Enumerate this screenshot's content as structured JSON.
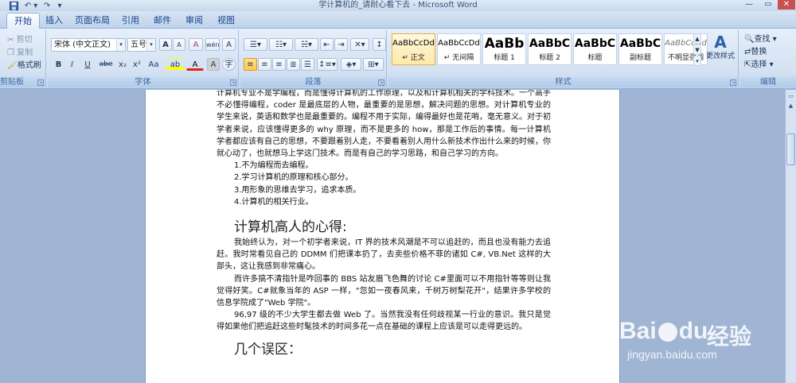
{
  "window": {
    "title": "学计算机的_请耐心看下去 - Microsoft Word",
    "quick_access": [
      "save-icon",
      "undo-icon",
      "redo-icon"
    ],
    "controls": [
      "minimize-icon",
      "maximize-icon",
      "close-icon"
    ]
  },
  "tabs": [
    "开始",
    "插入",
    "页面布局",
    "引用",
    "邮件",
    "审阅",
    "视图"
  ],
  "ribbon": {
    "clipboard": {
      "cut": "剪切",
      "copy": "复制",
      "format_painter": "格式刷",
      "label": "剪贴板"
    },
    "font": {
      "font_name": "宋体 (中文正文)",
      "font_size": "五号",
      "grow": "A",
      "shrink": "A",
      "clear": "A",
      "phonetic": "wén",
      "char_border": "A",
      "bold": "B",
      "italic": "I",
      "underline": "U",
      "strike": "abe",
      "subscript": "x₂",
      "superscript": "x²",
      "case": "Aa",
      "highlight": "ab",
      "font_color": "A",
      "char_shade": "A",
      "enclosed": "字",
      "label": "字体"
    },
    "paragraph": {
      "label": "段落"
    },
    "styles": {
      "items": [
        {
          "sample": "AaBbCcDd",
          "name": "↵ 正文"
        },
        {
          "sample": "AaBbCcDd",
          "name": "↵ 无间隔"
        },
        {
          "sample": "AaBb",
          "name": "标题 1"
        },
        {
          "sample": "AaBbC",
          "name": "标题 2"
        },
        {
          "sample": "AaBbC",
          "name": "标题"
        },
        {
          "sample": "AaBbC",
          "name": "副标题"
        },
        {
          "sample": "AaBbCcDd",
          "name": "不明显强调"
        }
      ],
      "change_styles": "更改样式",
      "label": "样式"
    },
    "editing": {
      "find": "查找 ▾",
      "replace": "替换",
      "select": "选择 ▾",
      "label": "编辑"
    }
  },
  "document": {
    "paragraphs_top": [
      "计算机专业不是学编程，而是懂得计算机的工作原理，以及和计算机相关的学科技术。一个高手不必懂得编程，coder 是最底层的人物，最重要的是思想，解决问题的思想。对计算机专业的学生来说，英语和数学也是最重要的。编程不用于实际，编得最好也是花哨，毫无意义。对于初学者来说，应该懂得更多的 why 原理，而不是更多的 how，那是工作后的事情。每一计算机学者都应该有自己的思想，不要跟着别人走，不要看着别人用什么新技术作出什么来的时候，你就心动了，也就想马上学这门技术。而是有自己的学习思路，和自己学习的方向。"
    ],
    "list": [
      "1.不为编程而去编程。",
      "2.学习计算机的原理和核心部分。",
      "3.用形象的思维去学习，追求本质。",
      "4.计算机的相关行业。"
    ],
    "heading1": "计算机高人的心得:",
    "paragraphs_mid": [
      "我始终认为，对一个初学者来说，IT 界的技术风潮是不可以追赶的，而且也没有能力去追赶。我时常看见自己的 DDMM 们把课本扔了，去卖些价格不菲的诸如 C#, VB.Net 这样的大部头，这让我感到非常痛心。",
      "而许多搞不清指针是咋回事的 BBS 站友眉飞色舞的讨论 C#里面可以不用指针等等则让我觉得好笑。C#就象当年的 ASP 一样，\"忽如一夜春风来，千树万树梨花开\"，结果许多学校的信息学院成了\"Web 学院\"。",
      "96,97 级的不少大学生都去做 Web 了。当然我没有任何歧视某一行业的意识。我只是觉得如果他们把追赶这些时髦技术的时间多花一点在基础的课程上应该是可以走得更远的。"
    ],
    "heading2": "几个误区："
  },
  "watermark": {
    "brand": "Bai",
    "brand_suffix": "du",
    "cn": "经验",
    "url": "jingyan.baidu.com"
  }
}
